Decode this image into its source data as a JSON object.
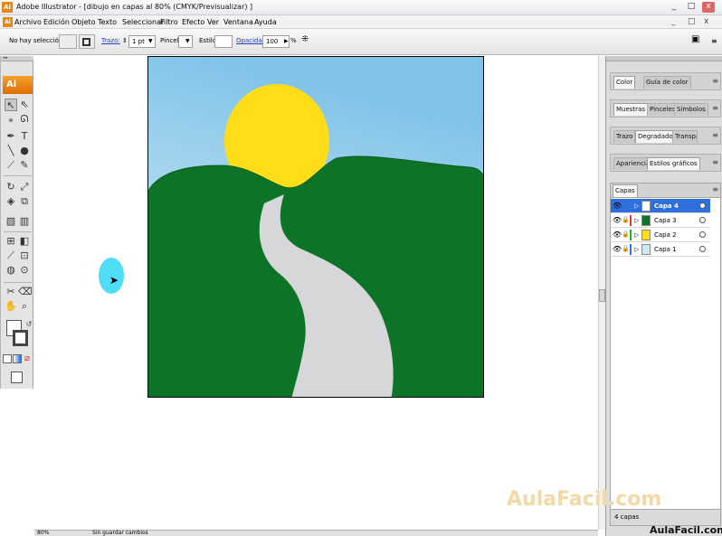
{
  "window": {
    "title": "Adobe Illustrator - [dibujo en capas al 80% (CMYK/Previsualizar) ]",
    "app_icon": "Ai",
    "minimize": "_",
    "maximize": "□",
    "close": "x"
  },
  "menubar": {
    "items": [
      "Archivo",
      "Edición",
      "Objeto",
      "Texto",
      "Seleccionar",
      "Filtro",
      "Efecto",
      "Ver",
      "Ventana",
      "Ayuda"
    ],
    "doc_controls": [
      "_",
      "□",
      "x"
    ]
  },
  "controlbar": {
    "selection_status": "No hay selección",
    "trazo_label": "Trazo:",
    "stroke_weight": "1 pt",
    "pincel_label": "Pincel:",
    "estilo_label": "Estilo:",
    "opacidad_label": "Opacidad:",
    "opacity_value": "100",
    "percent": "%"
  },
  "toolbar": {
    "logo": "Ai",
    "grip": "◂◂"
  },
  "canvas": {
    "artboard_colors": {
      "sky_top": "#bfe0f2",
      "sky_bottom": "#f3f9fc",
      "sun": "#ffde19",
      "hills": "#0d7326",
      "road": "#d7d7d9"
    },
    "cursor_highlight": "#4fdcf5"
  },
  "statusbar": {
    "zoom": "80%",
    "status_text": "Sin guardar cambios"
  },
  "panels": {
    "color_group": {
      "tabs": [
        "Color",
        "Guía de color"
      ]
    },
    "swatches_group": {
      "tabs": [
        "Muestras",
        "Pinceles",
        "Símbolos"
      ]
    },
    "stroke_group": {
      "tabs": [
        "Trazo",
        "Degradado",
        "Transparencia"
      ]
    },
    "appearance_group": {
      "tabs": [
        "Apariencia",
        "Estilos gráficos"
      ]
    },
    "layers": {
      "tab": "Capas",
      "rows": [
        {
          "name": "Capa 4",
          "color": "#3a6fe8",
          "thumb": "#ffffff",
          "selected": true
        },
        {
          "name": "Capa 3",
          "color": "#e03838",
          "thumb": "#0d7326",
          "selected": false
        },
        {
          "name": "Capa 2",
          "color": "#2bb02b",
          "thumb": "#ffde19",
          "selected": false
        },
        {
          "name": "Capa 1",
          "color": "#3a6fe8",
          "thumb": "#cfe6f5",
          "selected": false
        }
      ],
      "count": "4 capas"
    }
  },
  "watermark": {
    "main": "AulaFacil.com",
    "corner": "AulaFacil.com"
  }
}
